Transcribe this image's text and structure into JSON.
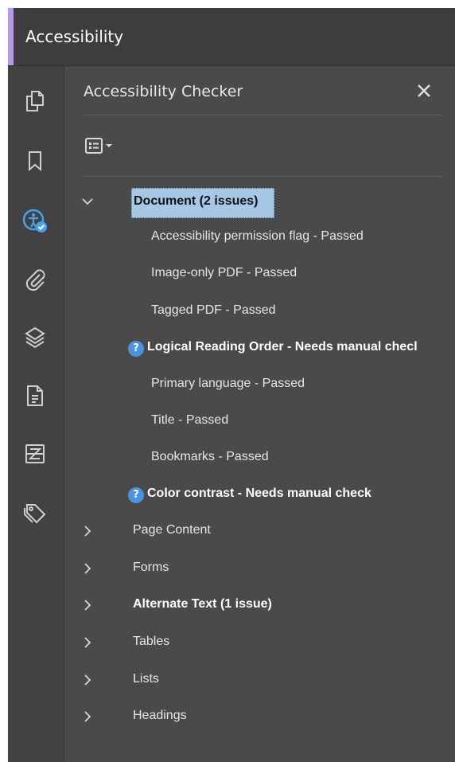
{
  "header": {
    "title": "Accessibility"
  },
  "rail": {
    "icons": [
      "pages-icon",
      "bookmark-icon",
      "accessibility-check-icon",
      "attachment-icon",
      "layers-icon",
      "document-icon",
      "compare-icon",
      "tags-icon"
    ]
  },
  "panel": {
    "title": "Accessibility Checker",
    "close_icon": "close-icon",
    "options_icon": "options-menu-icon"
  },
  "tree": {
    "document": {
      "label": "Document (2 issues)",
      "expanded": true
    },
    "document_children": [
      {
        "label": "Accessibility permission flag - Passed",
        "status": "passed"
      },
      {
        "label": "Image-only PDF - Passed",
        "status": "passed"
      },
      {
        "label": "Tagged PDF - Passed",
        "status": "passed"
      },
      {
        "label": "Logical Reading Order - Needs manual checl",
        "status": "manual"
      },
      {
        "label": "Primary language - Passed",
        "status": "passed"
      },
      {
        "label": "Title - Passed",
        "status": "passed"
      },
      {
        "label": "Bookmarks - Passed",
        "status": "passed"
      },
      {
        "label": "Color contrast - Needs manual check",
        "status": "manual"
      }
    ],
    "categories": [
      {
        "label": "Page Content",
        "bold": false
      },
      {
        "label": "Forms",
        "bold": false
      },
      {
        "label": "Alternate Text (1 issue)",
        "bold": true
      },
      {
        "label": "Tables",
        "bold": false
      },
      {
        "label": "Lists",
        "bold": false
      },
      {
        "label": "Headings",
        "bold": false
      }
    ],
    "manual_check_icon": "?"
  },
  "colors": {
    "accent": "#b79be3",
    "selection": "#a6c7e6",
    "help_icon": "#4a93e0",
    "active_icon": "#4aa3e8"
  }
}
